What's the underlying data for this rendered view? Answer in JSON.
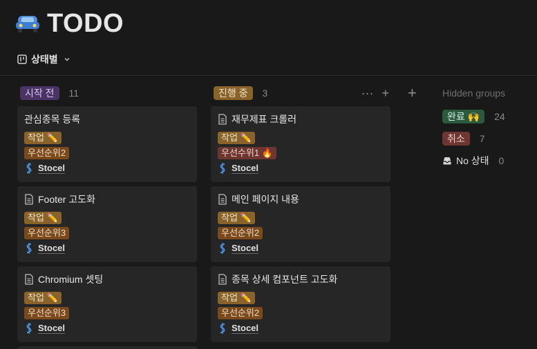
{
  "page": {
    "title": "TODO",
    "icon": "car-icon"
  },
  "view": {
    "label": "상태별",
    "icon": "board-icon"
  },
  "columns": [
    {
      "label": "시작 전",
      "count": "11",
      "color": "#4b3366",
      "text_color": "#d9c8f0",
      "cards": [
        {
          "title": "관심종목 등록",
          "has_doc_icon": false,
          "task": "작업 ✏️",
          "priority": "우선순위2",
          "priority_style": "normal",
          "person": "Stocel"
        },
        {
          "title": "Footer 고도화",
          "has_doc_icon": true,
          "task": "작업 ✏️",
          "priority": "우선순위3",
          "priority_style": "normal",
          "person": "Stocel"
        },
        {
          "title": "Chromium 셋팅",
          "has_doc_icon": true,
          "task": "작업 ✏️",
          "priority": "우선순위3",
          "priority_style": "normal",
          "person": "Stocel"
        }
      ]
    },
    {
      "label": "진행 중",
      "count": "3",
      "color": "#89632a",
      "text_color": "#f1e3c9",
      "cards": [
        {
          "title": "재무제표 크롤러",
          "has_doc_icon": true,
          "task": "작업 ✏️",
          "priority": "우선수위1 🔥",
          "priority_style": "high",
          "person": "Stocel"
        },
        {
          "title": "메인 페이지 내용",
          "has_doc_icon": true,
          "task": "작업 ✏️",
          "priority": "우선순위2",
          "priority_style": "normal",
          "person": "Stocel"
        },
        {
          "title": "종목 상세 컴포넌트 고도화",
          "has_doc_icon": true,
          "task": "작업 ✏️",
          "priority": "우선순위2",
          "priority_style": "normal",
          "person": "Stocel"
        }
      ]
    }
  ],
  "hidden_groups": {
    "title": "Hidden groups",
    "items": [
      {
        "label": "완료 🙌",
        "count": "24",
        "color": "#2b5a3f",
        "text_color": "#d4eedd"
      },
      {
        "label": "취소",
        "count": "7",
        "color": "#6e3630",
        "text_color": "#f3d2cd"
      },
      {
        "label": "No 상태",
        "count": "0",
        "icon": "inbox-icon"
      }
    ]
  }
}
